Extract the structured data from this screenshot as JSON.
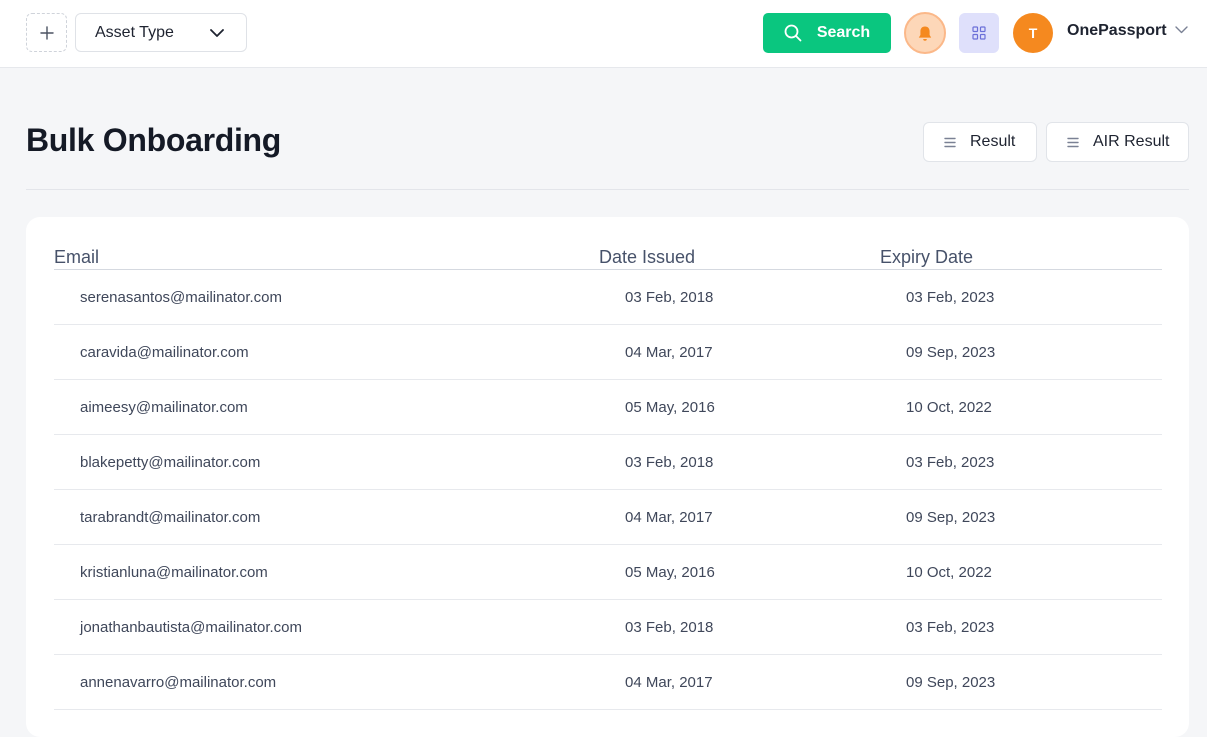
{
  "topbar": {
    "asset_type_label": "Asset Type",
    "search_label": "Search",
    "avatar_initial": "T",
    "account_name": "OnePassport"
  },
  "page": {
    "title": "Bulk Onboarding",
    "result_label": "Result",
    "air_result_label": "AIR Result"
  },
  "table": {
    "headers": {
      "email": "Email",
      "date_issued": "Date Issued",
      "expiry_date": "Expiry Date"
    },
    "rows": [
      {
        "email": "serenasantos@mailinator.com",
        "date_issued": "03 Feb, 2018",
        "expiry_date": "03 Feb, 2023"
      },
      {
        "email": "caravida@mailinator.com",
        "date_issued": "04 Mar, 2017",
        "expiry_date": "09 Sep, 2023"
      },
      {
        "email": "aimeesy@mailinator.com",
        "date_issued": "05 May, 2016",
        "expiry_date": "10 Oct, 2022"
      },
      {
        "email": "blakepetty@mailinator.com",
        "date_issued": "03 Feb, 2018",
        "expiry_date": "03 Feb, 2023"
      },
      {
        "email": "tarabrandt@mailinator.com",
        "date_issued": "04 Mar, 2017",
        "expiry_date": "09 Sep, 2023"
      },
      {
        "email": "kristianluna@mailinator.com",
        "date_issued": "05 May, 2016",
        "expiry_date": "10 Oct, 2022"
      },
      {
        "email": "jonathanbautista@mailinator.com",
        "date_issued": "03 Feb, 2018",
        "expiry_date": "03 Feb, 2023"
      },
      {
        "email": "annenavarro@mailinator.com",
        "date_issued": "04 Mar, 2017",
        "expiry_date": "09 Sep, 2023"
      }
    ]
  },
  "icons": {
    "add": "plus-icon",
    "dropdown": "chevron-down-icon",
    "search": "search-icon",
    "notifications": "bell-icon",
    "apps": "grid-icon",
    "list": "menu-lines-icon"
  },
  "colors": {
    "search_button": "#0ac67f",
    "bell_background": "#fdd7b8",
    "bell_icon": "#f5891f",
    "grid_background": "#dfe0fb",
    "grid_icon": "#6b6fd8",
    "avatar": "#f5891f"
  }
}
